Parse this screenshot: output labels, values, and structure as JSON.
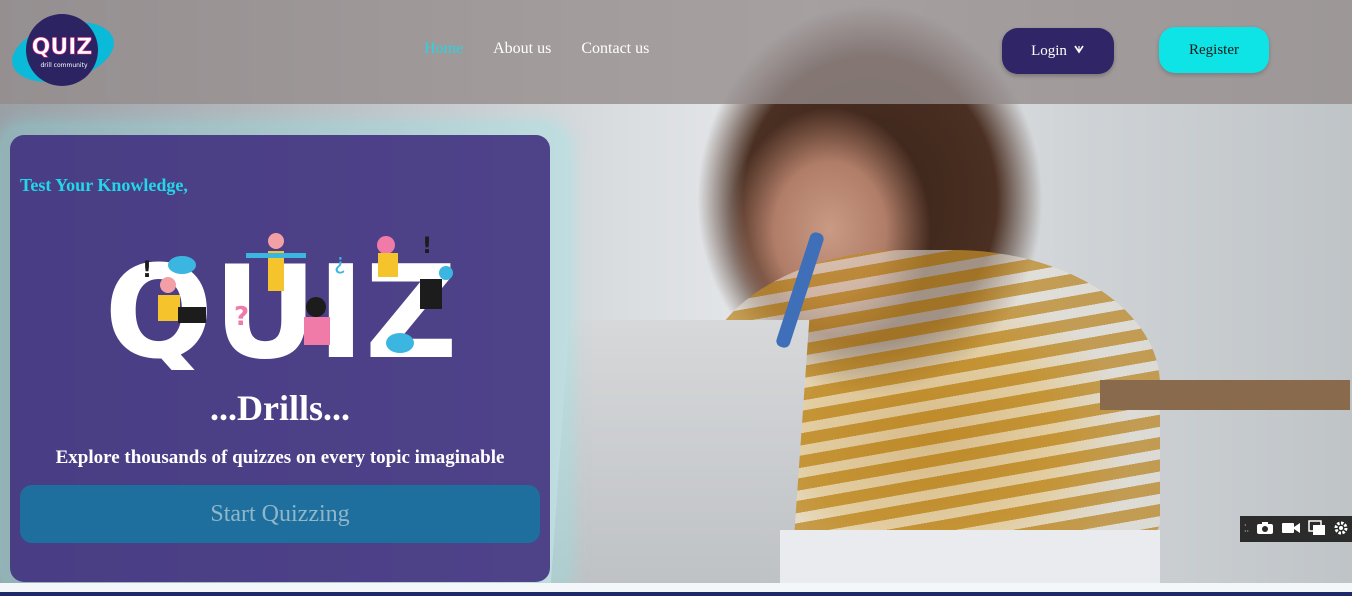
{
  "navbar": {
    "logo": {
      "text": "QUIZ",
      "subtext": "drill community"
    },
    "links": [
      {
        "label": "Home",
        "active": true
      },
      {
        "label": "About us",
        "active": false
      },
      {
        "label": "Contact us",
        "active": false
      }
    ],
    "login_label": "Login",
    "register_label": "Register"
  },
  "hero": {
    "tagline": "Test Your Knowledge,",
    "art_word": "QUIZ",
    "title": "...Drills...",
    "subtitle": "Explore thousands of quizzes on every topic imaginable",
    "cta_label": "Start Quizzing"
  },
  "colors": {
    "accent": "#0ee3e6",
    "primary": "#2f2567",
    "card": "#3f2c7d",
    "cta": "#1f6f9e"
  },
  "icons": [
    "chevron-down-icon",
    "camera-icon",
    "video-icon",
    "copy-icon",
    "gear-icon"
  ]
}
